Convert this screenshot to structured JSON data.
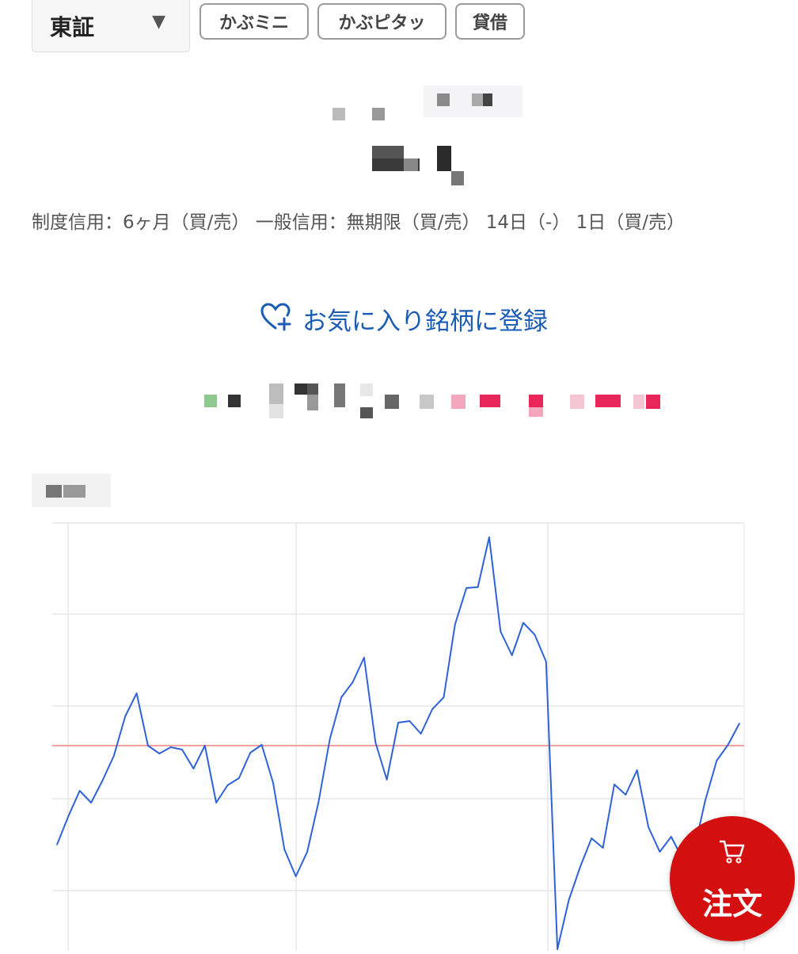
{
  "exchange": {
    "value": "東証",
    "arrow": "▼"
  },
  "tags": [
    {
      "label": "かぶミニ"
    },
    {
      "label": "かぶピタッ"
    },
    {
      "label": "貸借"
    }
  ],
  "credit_info": "制度信用：6ヶ月（買/売） 一般信用：無期限（買/売） 14日（-） 1日（買/売）",
  "favorite": {
    "label": "お気に入り銘柄に登録",
    "icon": "heart-plus-icon",
    "color": "#1a5bb5"
  },
  "order_button": {
    "label": "注文",
    "icon": "cart-icon",
    "color": "#d40f10"
  },
  "chart_data": {
    "type": "line",
    "title": "",
    "xlabel": "",
    "ylabel": "",
    "x": [
      0,
      1,
      2,
      3,
      4,
      5,
      6,
      7,
      8,
      9,
      10,
      11,
      12,
      13,
      14,
      15,
      16,
      17,
      18,
      19,
      20,
      21,
      22,
      23,
      24,
      25,
      26,
      27,
      28,
      29,
      30,
      31,
      32,
      33,
      34,
      35,
      36,
      37,
      38,
      39,
      40,
      41,
      42,
      43,
      44,
      45,
      46,
      47,
      48,
      49,
      50,
      51,
      52,
      53,
      54,
      55,
      56,
      57,
      58,
      59,
      60
    ],
    "series": [
      {
        "color": "#2f62d8",
        "values": [
          1066,
          1030,
          998,
          1013,
          985,
          954,
          904,
          875,
          941,
          951,
          943,
          946,
          970,
          941,
          1013,
          991,
          982,
          950,
          940,
          988,
          1072,
          1106,
          1075,
          1012,
          932,
          880,
          861,
          830,
          937,
          984,
          912,
          910,
          926,
          895,
          880,
          788,
          742,
          741,
          678,
          797,
          827,
          786,
          801,
          835,
          1198,
          1136,
          1094,
          1058,
          1070,
          990,
          1003,
          972,
          1044,
          1075,
          1056,
          1084,
          1074,
          1010,
          960,
          940,
          913
        ]
      }
    ],
    "reference_line": {
      "color": "#f2a0a0"
    },
    "ylim": [
      1200,
      640
    ],
    "grid": true
  }
}
